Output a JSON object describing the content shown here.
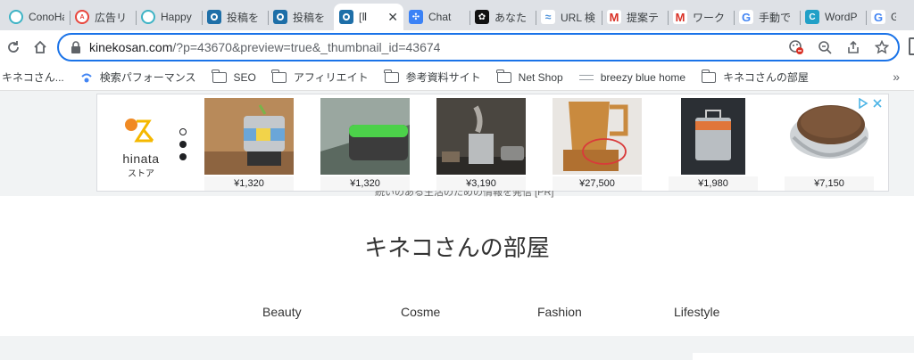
{
  "tabs": [
    {
      "title": "ConoHa",
      "icon": "conoha-icon",
      "color": "#3db3c5"
    },
    {
      "title": "広告リ",
      "icon": "ads-icon",
      "color": "#e8453c"
    },
    {
      "title": "Happy",
      "icon": "happy-icon",
      "color": "#3db3c5"
    },
    {
      "title": "投稿を",
      "icon": "wordpress-icon",
      "color": "#1e6fa8"
    },
    {
      "title": "投稿を",
      "icon": "wordpress-icon",
      "color": "#1e6fa8"
    },
    {
      "title": "[Ⅱ",
      "icon": "wordpress-icon",
      "color": "#1e6fa8",
      "active": true
    },
    {
      "title": "Chat",
      "icon": "chat-icon",
      "color": "#3b82f6"
    },
    {
      "title": "あなた",
      "icon": "openai-icon",
      "color": "#111111"
    },
    {
      "title": "URL 検",
      "icon": "url-icon",
      "color": "#4a90d9"
    },
    {
      "title": "提案テ",
      "icon": "gmail-icon",
      "color": "#d93025"
    },
    {
      "title": "ワーク",
      "icon": "gmail-icon",
      "color": "#d93025"
    },
    {
      "title": "手動で",
      "icon": "google-icon",
      "color": "#4285f4"
    },
    {
      "title": "WordP",
      "icon": "wordpress-icon",
      "color": "#21a0c7"
    },
    {
      "title": "Goo",
      "icon": "google-icon",
      "color": "#4285f4"
    }
  ],
  "toolbar": {
    "url_host": "kinekosan.com",
    "url_rest": "/?p=43670&preview=true&_thumbnail_id=43674"
  },
  "bookmarks": [
    {
      "label": "キネコさん...",
      "icon": "site-icon"
    },
    {
      "label": "検索パフォーマンス",
      "icon": "search-console-icon"
    },
    {
      "label": "SEO",
      "icon": "folder-icon"
    },
    {
      "label": "アフィリエイト",
      "icon": "folder-icon"
    },
    {
      "label": "参考資料サイト",
      "icon": "folder-icon"
    },
    {
      "label": "Net Shop",
      "icon": "folder-icon"
    },
    {
      "label": "breezy blue home",
      "icon": "bookmark-icon"
    },
    {
      "label": "キネコさんの部屋",
      "icon": "folder-icon"
    }
  ],
  "bookmarks_more": "»",
  "ad": {
    "brand": "hinata",
    "brand_sub": "ストア",
    "products": [
      {
        "price": "¥1,320"
      },
      {
        "price": "¥1,320"
      },
      {
        "price": "¥3,190"
      },
      {
        "price": "¥27,500"
      },
      {
        "price": "¥1,980"
      },
      {
        "price": "¥7,150"
      }
    ]
  },
  "page": {
    "cropped_line": "続いのある生活のための情報を発信 [PR]",
    "site_title": "キネコさんの部屋",
    "menu": [
      "Beauty",
      "Cosme",
      "Fashion",
      "Lifestyle"
    ]
  },
  "colors": {
    "accent": "#1a73e8",
    "tabstrip": "#dee1e6"
  }
}
